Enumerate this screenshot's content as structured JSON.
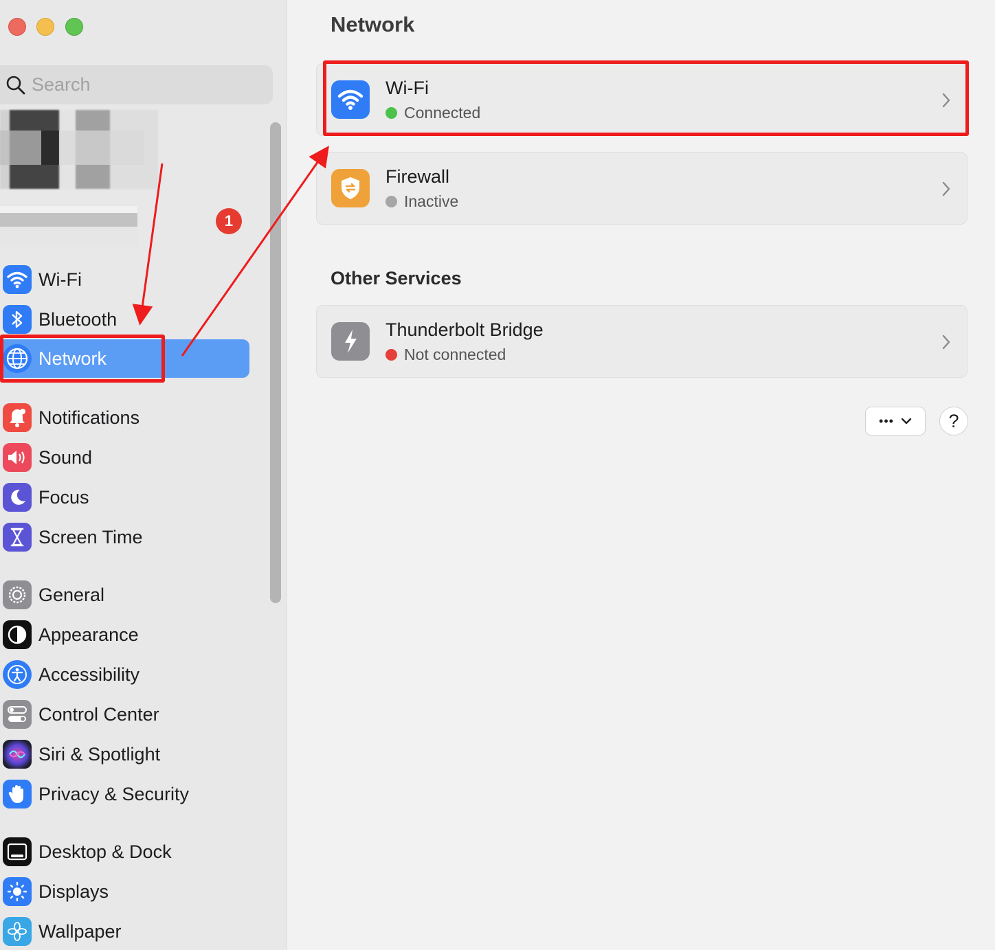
{
  "search": {
    "placeholder": "Search"
  },
  "badge": {
    "number": "1"
  },
  "sidebar": {
    "items": [
      {
        "label": "Wi-Fi",
        "icon": "wifi-icon"
      },
      {
        "label": "Bluetooth",
        "icon": "bluetooth-icon"
      },
      {
        "label": "Network",
        "icon": "globe-icon",
        "selected": true
      },
      {
        "label": "Notifications",
        "icon": "bell-icon"
      },
      {
        "label": "Sound",
        "icon": "speaker-icon"
      },
      {
        "label": "Focus",
        "icon": "moon-icon"
      },
      {
        "label": "Screen Time",
        "icon": "hourglass-icon"
      },
      {
        "label": "General",
        "icon": "gear-icon"
      },
      {
        "label": "Appearance",
        "icon": "appearance-icon"
      },
      {
        "label": "Accessibility",
        "icon": "accessibility-icon"
      },
      {
        "label": "Control Center",
        "icon": "toggles-icon"
      },
      {
        "label": "Siri & Spotlight",
        "icon": "siri-icon"
      },
      {
        "label": "Privacy & Security",
        "icon": "hand-icon"
      },
      {
        "label": "Desktop & Dock",
        "icon": "dock-icon"
      },
      {
        "label": "Displays",
        "icon": "sun-icon"
      },
      {
        "label": "Wallpaper",
        "icon": "flower-icon"
      }
    ]
  },
  "main": {
    "title": "Network",
    "services": [
      {
        "title": "Wi-Fi",
        "status": "Connected",
        "status_color": "#4cc24a",
        "icon": "wifi-icon"
      },
      {
        "title": "Firewall",
        "status": "Inactive",
        "status_color": "#a6a6a6",
        "icon": "firewall-icon"
      }
    ],
    "other_title": "Other Services",
    "other_services": [
      {
        "title": "Thunderbolt Bridge",
        "status": "Not connected",
        "status_color": "#e5403a",
        "icon": "thunderbolt-icon"
      }
    ],
    "more_label": "•••",
    "help_label": "?"
  },
  "colors": {
    "accent": "#5b9cf5",
    "highlight": "#ee1c1c"
  }
}
